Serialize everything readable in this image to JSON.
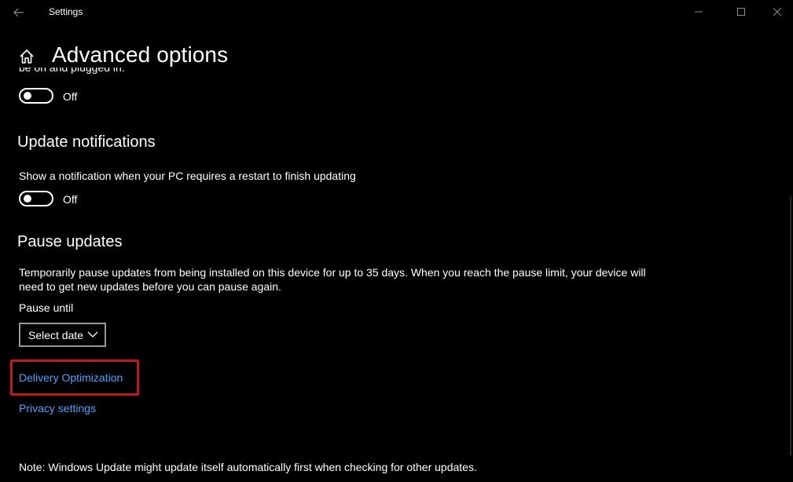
{
  "window": {
    "app_title": "Settings",
    "icons": {
      "back": "back-arrow-icon",
      "minimize": "minimize-icon",
      "maximize": "maximize-icon",
      "close": "close-icon",
      "home": "home-icon",
      "dropdown": "chevron-down-icon"
    }
  },
  "header": {
    "title": "Advanced options"
  },
  "restart_section": {
    "clipped_text": "be on and plugged in.",
    "toggle": {
      "state": "Off"
    }
  },
  "update_notifications": {
    "title": "Update notifications",
    "description": "Show a notification when your PC requires a restart to finish updating",
    "toggle": {
      "state": "Off"
    }
  },
  "pause_updates": {
    "title": "Pause updates",
    "description_line1": "Temporarily pause updates from being installed on this device for up to 35 days. When you reach the pause limit, your device will",
    "description_line2": "need to get new updates before you can pause again.",
    "pause_until_label": "Pause until",
    "select": {
      "value": "Select date"
    }
  },
  "links": {
    "delivery_optimization": "Delivery Optimization",
    "privacy_settings": "Privacy settings"
  },
  "footer": {
    "note": "Note: Windows Update might update itself automatically first when checking for other updates."
  },
  "colors": {
    "background": "#000000",
    "link": "#4aa3ff",
    "highlight": "#b01e23"
  }
}
